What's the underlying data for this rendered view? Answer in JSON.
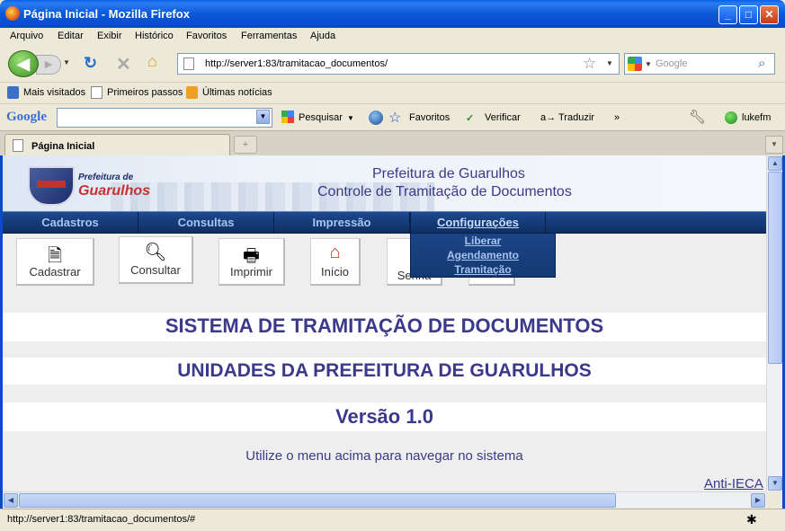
{
  "window": {
    "title": "Página Inicial - Mozilla Firefox",
    "minimize": "_",
    "maximize": "□",
    "close": "✕"
  },
  "menubar": [
    "Arquivo",
    "Editar",
    "Exibir",
    "Histórico",
    "Favoritos",
    "Ferramentas",
    "Ajuda"
  ],
  "nav": {
    "url": "http://server1:83/tramitacao_documentos/",
    "search_placeholder": "Google"
  },
  "bookmarks": [
    "Mais visitados",
    "Primeiros passos",
    "Últimas notícias"
  ],
  "google_toolbar": {
    "logo": "Google",
    "items": [
      "Pesquisar",
      "Favoritos",
      "Verificar",
      "Traduzir",
      "»",
      "lukefm"
    ]
  },
  "tab": {
    "label": "Página Inicial"
  },
  "page": {
    "header_line1": "Prefeitura de Guarulhos",
    "header_line2": "Controle de Tramitação de Documentos",
    "logo_line1": "Prefeitura de",
    "logo_line2": "Guarulhos",
    "menu": [
      "Cadastros",
      "Consultas",
      "Impressão",
      "Configurações"
    ],
    "submenu": [
      "Liberar",
      "Agendamento",
      "Tramitação"
    ],
    "toolbar": [
      "Cadastrar",
      "Consultar",
      "Imprimir",
      "Início",
      "Senha"
    ],
    "title1": "SISTEMA DE TRAMITAÇÃO DE DOCUMENTOS",
    "title2": "UNIDADES DA PREFEITURA DE GUARULHOS",
    "version": "Versão 1.0",
    "hint": "Utilize o menu acima para navegar no sistema",
    "anti_link": "Anti-IECA"
  },
  "status": {
    "text": "http://server1:83/tramitacao_documentos/#"
  }
}
